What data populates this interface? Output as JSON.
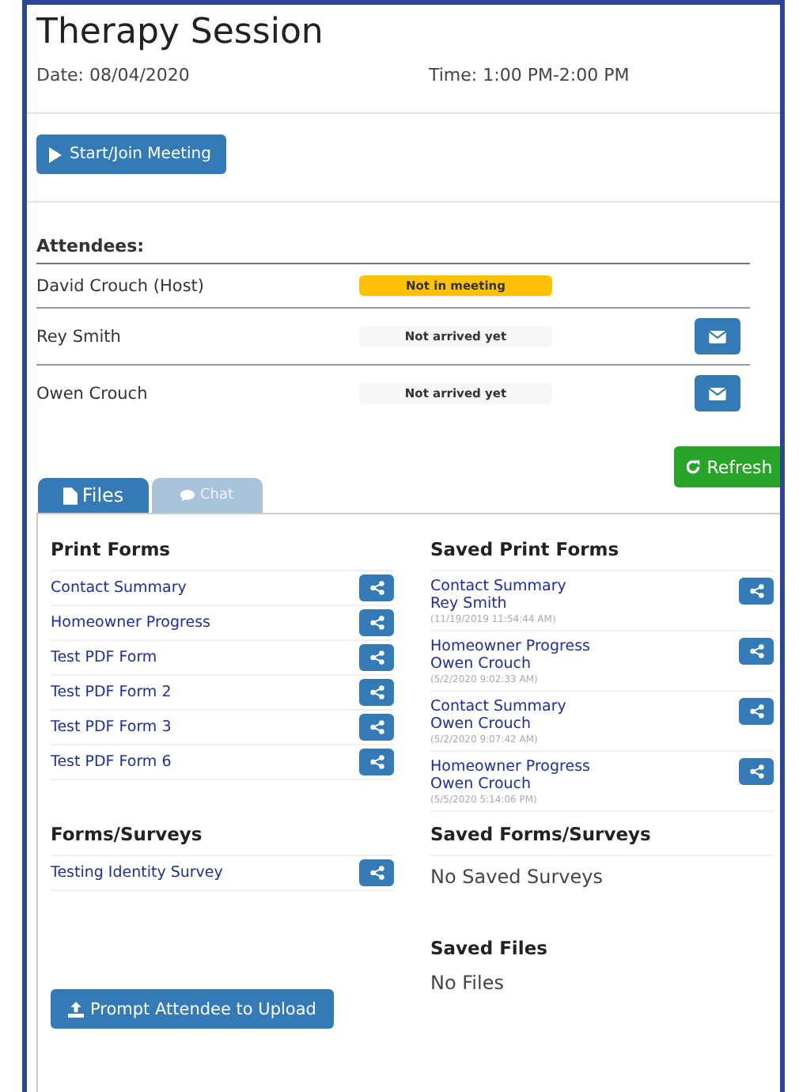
{
  "title": "Therapy Session",
  "date": "Date: 08/04/2020",
  "time": "Time: 1:00 PM-2:00 PM",
  "start_button": "Start/Join Meeting",
  "attendees_heading": "Attendees:",
  "attendees": [
    {
      "name": "David Crouch (Host)",
      "status": "Not in meeting",
      "kind": "host"
    },
    {
      "name": "Rey Smith",
      "status": "Not arrived yet",
      "kind": "guest"
    },
    {
      "name": "Owen Crouch",
      "status": "Not arrived yet",
      "kind": "guest"
    }
  ],
  "refresh_button": "Refresh",
  "tabs": [
    {
      "label": "Files",
      "kind": "files",
      "selected": true
    },
    {
      "label": "Chat",
      "kind": "chat",
      "selected": false
    }
  ],
  "print_forms": {
    "heading": "Print Forms",
    "items": [
      "Contact Summary",
      "Homeowner Progress",
      "Test PDF Form",
      "Test PDF Form 2",
      "Test PDF Form 3",
      "Test PDF Form 6"
    ]
  },
  "saved_print_forms": {
    "heading": "Saved Print Forms",
    "items": [
      {
        "form": "Contact Summary",
        "person": "Rey Smith",
        "timestamp": "(11/19/2019 11:54:44 AM)"
      },
      {
        "form": "Homeowner Progress",
        "person": "Owen Crouch",
        "timestamp": "(5/2/2020 9:02:33 AM)"
      },
      {
        "form": "Contact Summary",
        "person": "Owen Crouch",
        "timestamp": "(5/2/2020 9:07:42 AM)"
      },
      {
        "form": "Homeowner Progress",
        "person": "Owen Crouch",
        "timestamp": "(5/5/2020 5:14:06 PM)"
      }
    ]
  },
  "forms_surveys": {
    "heading": "Forms/Surveys",
    "items": [
      "Testing Identity Survey"
    ]
  },
  "saved_forms_surveys": {
    "heading": "Saved Forms/Surveys",
    "empty_text": "No Saved Surveys"
  },
  "upload_button": "Prompt Attendee to Upload",
  "saved_files": {
    "heading": "Saved Files",
    "empty_text": "No Files"
  }
}
